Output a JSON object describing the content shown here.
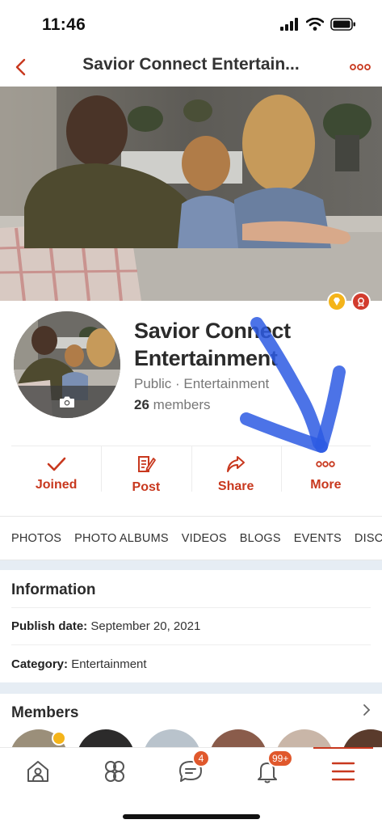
{
  "status": {
    "time": "11:46"
  },
  "nav": {
    "title": "Savior Connect Entertain..."
  },
  "group": {
    "name": "Savior Connect Entertainment",
    "meta": "Public · Entertainment",
    "member_count": "26",
    "member_suffix": "members"
  },
  "actions": [
    {
      "label": "Joined",
      "icon": "check-icon"
    },
    {
      "label": "Post",
      "icon": "post-icon"
    },
    {
      "label": "Share",
      "icon": "share-icon"
    },
    {
      "label": "More",
      "icon": "more-dots-icon"
    }
  ],
  "tabs": [
    "PHOTOS",
    "PHOTO ALBUMS",
    "VIDEOS",
    "BLOGS",
    "EVENTS",
    "DISCUSSIONS"
  ],
  "information": {
    "title": "Information",
    "publish_label": "Publish date:",
    "publish_value": "September 20, 2021",
    "category_label": "Category:",
    "category_value": "Entertainment"
  },
  "members": {
    "title": "Members"
  },
  "bottom_nav": {
    "items": [
      {
        "icon": "home-icon",
        "badge": ""
      },
      {
        "icon": "groups-icon",
        "badge": ""
      },
      {
        "icon": "chat-icon",
        "badge": "4"
      },
      {
        "icon": "bell-icon",
        "badge": "99+"
      },
      {
        "icon": "menu-icon",
        "badge": ""
      }
    ]
  },
  "colors": {
    "accent": "#c8381e",
    "badge": "#e0582c",
    "separator": "#e6edf4",
    "annotation": "#2d5be3"
  }
}
